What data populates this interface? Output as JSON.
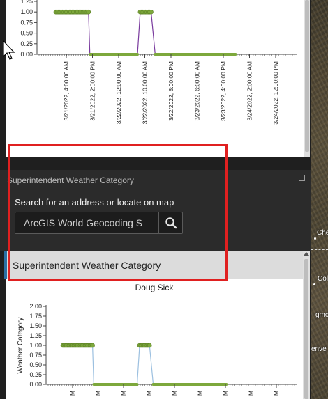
{
  "top_chart": {
    "y_ticks": [
      "1.25",
      "1.00",
      "0.75",
      "0.50",
      "0.25",
      "0.00"
    ],
    "x_ticks": [
      "3/21/2022, 4:00:00 AM",
      "3/21/2022, 2:00:00 PM",
      "3/22/2022, 12:00:00 AM",
      "3/22/2022, 10:00:00 AM",
      "3/22/2022, 8:00:00 PM",
      "3/23/2022, 6:00:00 AM",
      "3/23/2022, 4:00:00 PM",
      "3/24/2022, 2:00:00 AM",
      "3/24/2022, 12:00:00 PM"
    ]
  },
  "search_panel": {
    "title": "Superintendent Weather Category",
    "label": "Search for an address or locate on map",
    "input_value": "ArcGIS World Geocoding S",
    "search_icon": "search-icon",
    "maximize_icon": "maximize-icon"
  },
  "bottom_panel": {
    "title": "Superintendent Weather Category",
    "subtitle": "Doug Sick",
    "y_ticks": [
      "2.00",
      "1.75",
      "1.50",
      "1.25",
      "1.00",
      "0.75",
      "0.50",
      "0.25",
      "0.00"
    ],
    "ylabel": "Weather Category",
    "x_tick_fragments": [
      "M",
      "M",
      "M",
      "M",
      "M",
      "M",
      "M",
      "M",
      "M"
    ]
  },
  "map": {
    "labels": [
      "Che",
      "Col",
      "gmo",
      "enve"
    ]
  },
  "colors": {
    "line_top": "#7a3b9e",
    "line_bottom": "#9cc0e0",
    "marker": "#7da83c",
    "highlight_box": "#e02020"
  },
  "chart_data": [
    {
      "type": "line",
      "ylim": [
        0,
        1.25
      ],
      "y_ticks": [
        1.25,
        1.0,
        0.75,
        0.5,
        0.25,
        0.0
      ],
      "x": [
        "3/21/2022, 4:00:00 AM",
        "3/21/2022, 2:00:00 PM",
        "3/22/2022, 12:00:00 AM",
        "3/22/2022, 10:00:00 AM",
        "3/22/2022, 8:00:00 PM",
        "3/23/2022, 6:00:00 AM",
        "3/23/2022, 4:00:00 PM",
        "3/24/2022, 2:00:00 AM",
        "3/24/2022, 12:00:00 PM"
      ],
      "series": [
        {
          "x_hours": [
            0,
            1,
            2,
            3,
            4,
            5,
            6,
            7,
            8,
            9,
            10,
            11,
            12,
            12.5,
            30,
            31,
            32,
            33,
            34,
            35,
            36.5,
            66
          ],
          "values": [
            1,
            1,
            1,
            1,
            1,
            1,
            1,
            1,
            1,
            1,
            1,
            1,
            1,
            0,
            0,
            1,
            1,
            1,
            1,
            1,
            0,
            0
          ]
        }
      ]
    },
    {
      "type": "line",
      "title": "Doug Sick",
      "ylabel": "Weather Category",
      "ylim": [
        0,
        2.0
      ],
      "y_ticks": [
        2.0,
        1.75,
        1.5,
        1.25,
        1.0,
        0.75,
        0.5,
        0.25,
        0.0
      ],
      "series": [
        {
          "x_hours": [
            0,
            1,
            2,
            3,
            4,
            5,
            6,
            7,
            8,
            9,
            10,
            11,
            12,
            12.5,
            30,
            31,
            32,
            33,
            34,
            35,
            36.5,
            66
          ],
          "values": [
            1,
            1,
            1,
            1,
            1,
            1,
            1,
            1,
            1,
            1,
            1,
            1,
            1,
            0,
            0,
            1,
            1,
            1,
            1,
            1,
            0,
            0
          ]
        }
      ]
    }
  ]
}
